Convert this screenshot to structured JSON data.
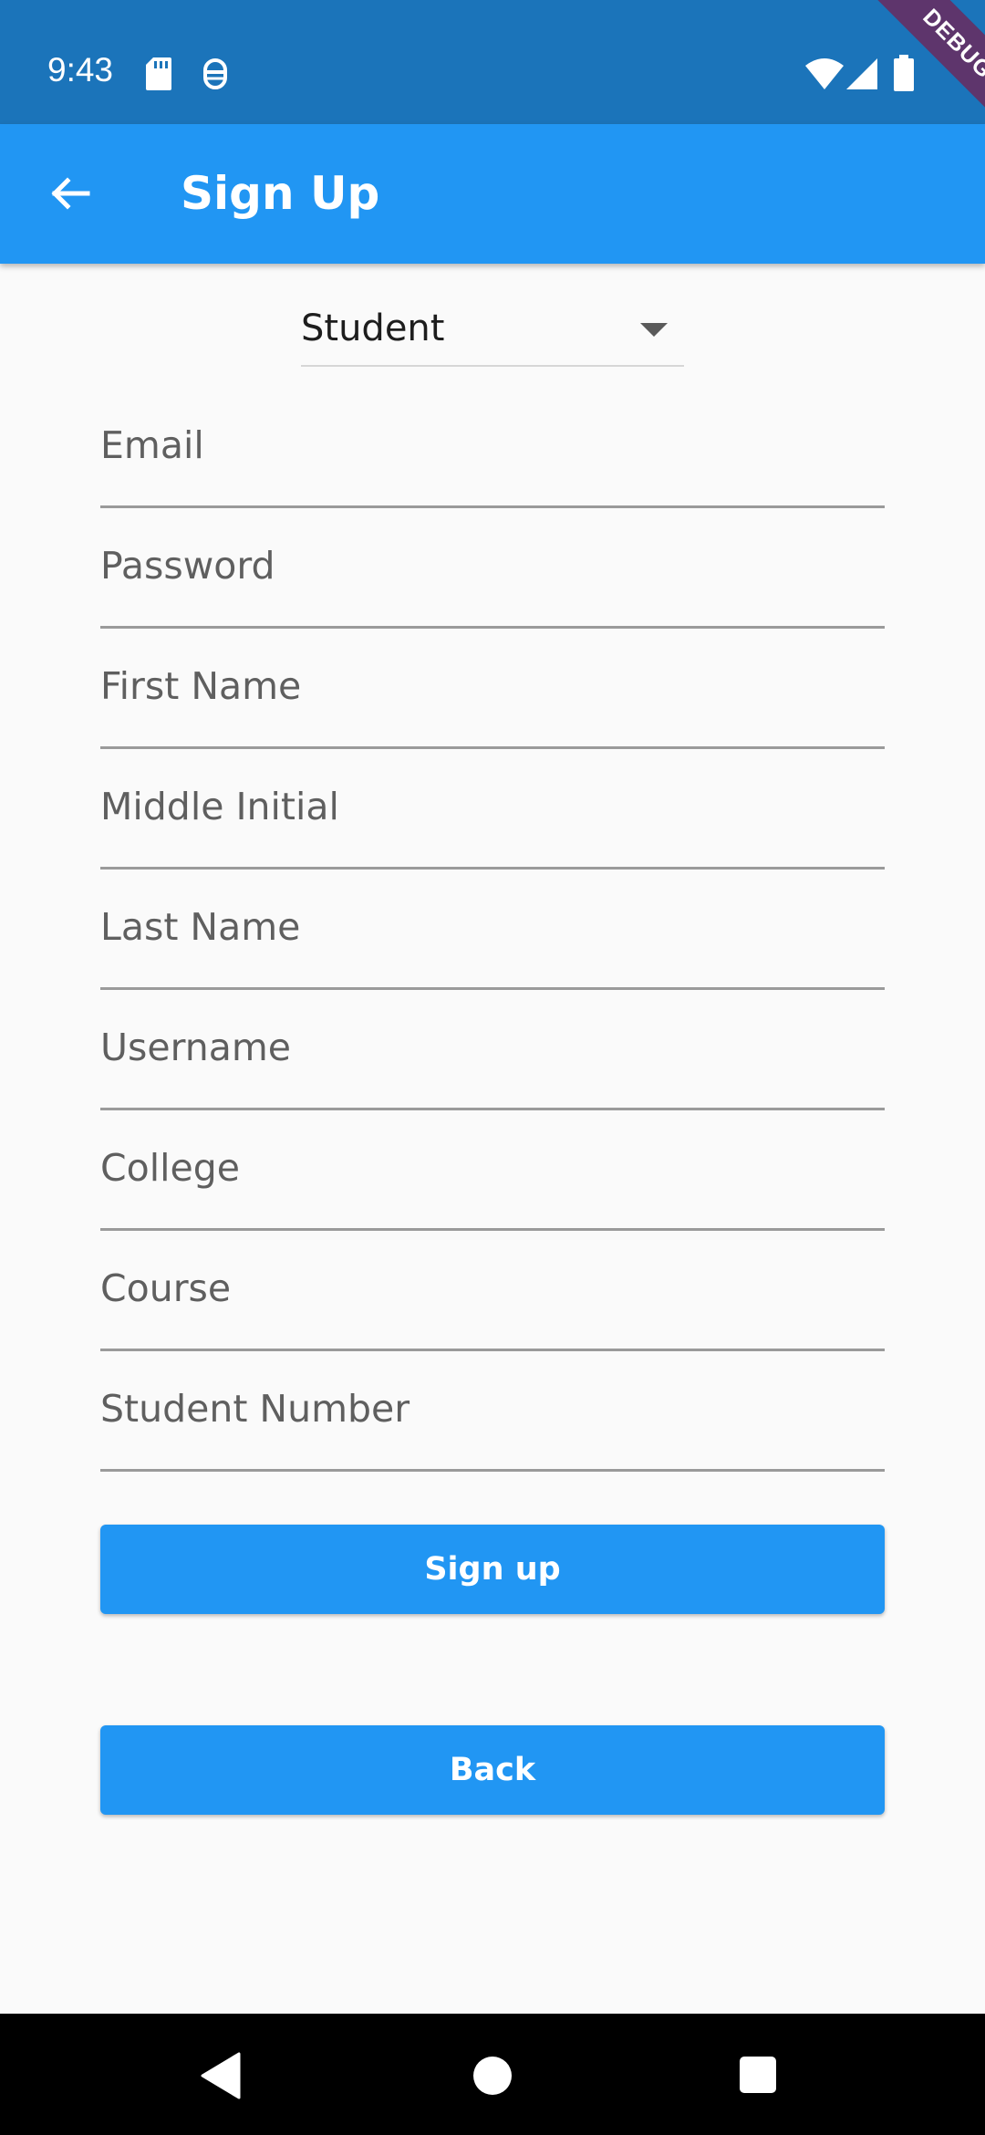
{
  "status_bar": {
    "time": "9:43",
    "icons": [
      "sd-card-icon",
      "bug-icon",
      "wifi-icon",
      "signal-icon",
      "battery-icon"
    ],
    "background": "#1b74ba"
  },
  "debug_banner": "DEBUG",
  "app_bar": {
    "title": "Sign Up",
    "back_icon": "arrow-back-icon",
    "background": "#2196f3"
  },
  "role_dropdown": {
    "selected": "Student"
  },
  "form": {
    "fields": [
      {
        "label": "Email"
      },
      {
        "label": "Password"
      },
      {
        "label": "First Name"
      },
      {
        "label": "Middle Initial"
      },
      {
        "label": "Last Name"
      },
      {
        "label": "Username"
      },
      {
        "label": "College"
      },
      {
        "label": "Course"
      },
      {
        "label": "Student Number"
      }
    ]
  },
  "buttons": {
    "sign_up": "Sign up",
    "back": "Back",
    "color": "#2196f3"
  },
  "nav_bar": {
    "icons": [
      "nav-back-icon",
      "nav-home-icon",
      "nav-recents-icon"
    ]
  }
}
